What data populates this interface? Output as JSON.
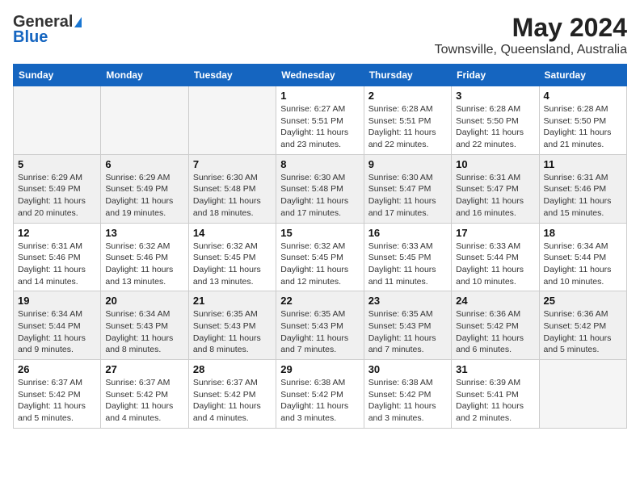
{
  "logo": {
    "general": "General",
    "blue": "Blue"
  },
  "title": "May 2024",
  "location": "Townsville, Queensland, Australia",
  "days_of_week": [
    "Sunday",
    "Monday",
    "Tuesday",
    "Wednesday",
    "Thursday",
    "Friday",
    "Saturday"
  ],
  "weeks": [
    [
      {
        "num": "",
        "info": ""
      },
      {
        "num": "",
        "info": ""
      },
      {
        "num": "",
        "info": ""
      },
      {
        "num": "1",
        "info": "Sunrise: 6:27 AM\nSunset: 5:51 PM\nDaylight: 11 hours and 23 minutes."
      },
      {
        "num": "2",
        "info": "Sunrise: 6:28 AM\nSunset: 5:51 PM\nDaylight: 11 hours and 22 minutes."
      },
      {
        "num": "3",
        "info": "Sunrise: 6:28 AM\nSunset: 5:50 PM\nDaylight: 11 hours and 22 minutes."
      },
      {
        "num": "4",
        "info": "Sunrise: 6:28 AM\nSunset: 5:50 PM\nDaylight: 11 hours and 21 minutes."
      }
    ],
    [
      {
        "num": "5",
        "info": "Sunrise: 6:29 AM\nSunset: 5:49 PM\nDaylight: 11 hours and 20 minutes."
      },
      {
        "num": "6",
        "info": "Sunrise: 6:29 AM\nSunset: 5:49 PM\nDaylight: 11 hours and 19 minutes."
      },
      {
        "num": "7",
        "info": "Sunrise: 6:30 AM\nSunset: 5:48 PM\nDaylight: 11 hours and 18 minutes."
      },
      {
        "num": "8",
        "info": "Sunrise: 6:30 AM\nSunset: 5:48 PM\nDaylight: 11 hours and 17 minutes."
      },
      {
        "num": "9",
        "info": "Sunrise: 6:30 AM\nSunset: 5:47 PM\nDaylight: 11 hours and 17 minutes."
      },
      {
        "num": "10",
        "info": "Sunrise: 6:31 AM\nSunset: 5:47 PM\nDaylight: 11 hours and 16 minutes."
      },
      {
        "num": "11",
        "info": "Sunrise: 6:31 AM\nSunset: 5:46 PM\nDaylight: 11 hours and 15 minutes."
      }
    ],
    [
      {
        "num": "12",
        "info": "Sunrise: 6:31 AM\nSunset: 5:46 PM\nDaylight: 11 hours and 14 minutes."
      },
      {
        "num": "13",
        "info": "Sunrise: 6:32 AM\nSunset: 5:46 PM\nDaylight: 11 hours and 13 minutes."
      },
      {
        "num": "14",
        "info": "Sunrise: 6:32 AM\nSunset: 5:45 PM\nDaylight: 11 hours and 13 minutes."
      },
      {
        "num": "15",
        "info": "Sunrise: 6:32 AM\nSunset: 5:45 PM\nDaylight: 11 hours and 12 minutes."
      },
      {
        "num": "16",
        "info": "Sunrise: 6:33 AM\nSunset: 5:45 PM\nDaylight: 11 hours and 11 minutes."
      },
      {
        "num": "17",
        "info": "Sunrise: 6:33 AM\nSunset: 5:44 PM\nDaylight: 11 hours and 10 minutes."
      },
      {
        "num": "18",
        "info": "Sunrise: 6:34 AM\nSunset: 5:44 PM\nDaylight: 11 hours and 10 minutes."
      }
    ],
    [
      {
        "num": "19",
        "info": "Sunrise: 6:34 AM\nSunset: 5:44 PM\nDaylight: 11 hours and 9 minutes."
      },
      {
        "num": "20",
        "info": "Sunrise: 6:34 AM\nSunset: 5:43 PM\nDaylight: 11 hours and 8 minutes."
      },
      {
        "num": "21",
        "info": "Sunrise: 6:35 AM\nSunset: 5:43 PM\nDaylight: 11 hours and 8 minutes."
      },
      {
        "num": "22",
        "info": "Sunrise: 6:35 AM\nSunset: 5:43 PM\nDaylight: 11 hours and 7 minutes."
      },
      {
        "num": "23",
        "info": "Sunrise: 6:35 AM\nSunset: 5:43 PM\nDaylight: 11 hours and 7 minutes."
      },
      {
        "num": "24",
        "info": "Sunrise: 6:36 AM\nSunset: 5:42 PM\nDaylight: 11 hours and 6 minutes."
      },
      {
        "num": "25",
        "info": "Sunrise: 6:36 AM\nSunset: 5:42 PM\nDaylight: 11 hours and 5 minutes."
      }
    ],
    [
      {
        "num": "26",
        "info": "Sunrise: 6:37 AM\nSunset: 5:42 PM\nDaylight: 11 hours and 5 minutes."
      },
      {
        "num": "27",
        "info": "Sunrise: 6:37 AM\nSunset: 5:42 PM\nDaylight: 11 hours and 4 minutes."
      },
      {
        "num": "28",
        "info": "Sunrise: 6:37 AM\nSunset: 5:42 PM\nDaylight: 11 hours and 4 minutes."
      },
      {
        "num": "29",
        "info": "Sunrise: 6:38 AM\nSunset: 5:42 PM\nDaylight: 11 hours and 3 minutes."
      },
      {
        "num": "30",
        "info": "Sunrise: 6:38 AM\nSunset: 5:42 PM\nDaylight: 11 hours and 3 minutes."
      },
      {
        "num": "31",
        "info": "Sunrise: 6:39 AM\nSunset: 5:41 PM\nDaylight: 11 hours and 2 minutes."
      },
      {
        "num": "",
        "info": ""
      }
    ]
  ]
}
